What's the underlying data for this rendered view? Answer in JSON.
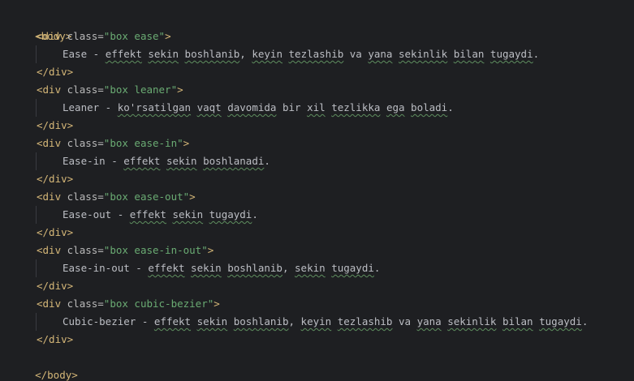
{
  "editor": {
    "body_open": "<body>",
    "body_close": "</body>",
    "div_close": "</div>",
    "div_open_prefix": "<div ",
    "attr_name": "class=",
    "tag_end": ">",
    "blocks": [
      {
        "class_value": "\"box ease\"",
        "text_parts": [
          "Ease - ",
          "effekt",
          " ",
          "sekin",
          " ",
          "boshlanib",
          ", ",
          "keyin",
          " ",
          "tezlashib",
          " va ",
          "yana",
          " ",
          "sekinlik",
          " ",
          "bilan",
          " ",
          "tugaydi",
          "."
        ]
      },
      {
        "class_value": "\"box leaner\"",
        "text_parts": [
          "Leaner - ",
          "ko'rsatilgan",
          " ",
          "vaqt",
          " ",
          "davomida",
          " bir ",
          "xil",
          " ",
          "tezlikka",
          " ",
          "ega",
          " ",
          "boladi",
          "."
        ]
      },
      {
        "class_value": "\"box ease-in\"",
        "text_parts": [
          "Ease-in - ",
          "effekt",
          " ",
          "sekin",
          " ",
          "boshlanadi",
          "."
        ]
      },
      {
        "class_value": "\"box ease-out\"",
        "text_parts": [
          "Ease-out - ",
          "effekt",
          " ",
          "sekin",
          " ",
          "tugaydi",
          "."
        ]
      },
      {
        "class_value": "\"box ease-in-out\"",
        "text_parts": [
          "Ease-in-out - ",
          "effekt",
          " ",
          "sekin",
          " ",
          "boshlanib",
          ", ",
          "sekin",
          " ",
          "tugaydi",
          "."
        ]
      },
      {
        "class_value": "\"box cubic-bezier\"",
        "text_parts": [
          "Cubic-bezier - ",
          "effekt",
          " ",
          "sekin",
          " ",
          "boshlanib",
          ", ",
          "keyin",
          " ",
          "tezlashib",
          " va ",
          "yana",
          " ",
          "sekinlik",
          " ",
          "bilan",
          " ",
          "tugaydi",
          "."
        ]
      }
    ]
  },
  "colors": {
    "background": "#1e1f22",
    "tag": "#d5b778",
    "string": "#6aab73",
    "text": "#bcbec4",
    "typo_underline": "#5f8f5f"
  }
}
